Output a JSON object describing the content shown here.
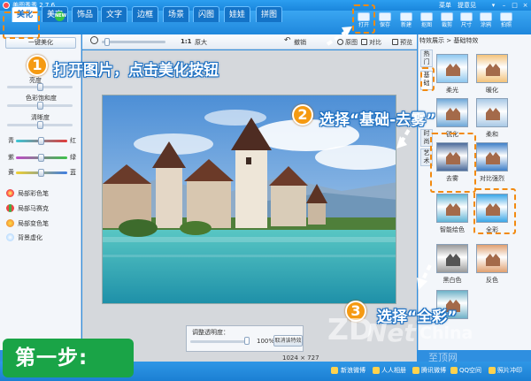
{
  "app": {
    "title": "美图秀秀 2.7.6"
  },
  "system_menu": {
    "menu": "菜单",
    "feedback": "提意见"
  },
  "tabs": [
    {
      "label": "美化"
    },
    {
      "label": "美容"
    },
    {
      "label": "饰品"
    },
    {
      "label": "文字"
    },
    {
      "label": "边框"
    },
    {
      "label": "场景"
    },
    {
      "label": "闪图"
    },
    {
      "label": "娃娃"
    },
    {
      "label": "拼图"
    }
  ],
  "new_badge": "NEW",
  "toolbar": [
    {
      "label": "打开",
      "icon": "folder-open-icon"
    },
    {
      "label": "保存",
      "icon": "save-icon"
    },
    {
      "label": "新建",
      "icon": "new-icon"
    },
    {
      "label": "抠图",
      "icon": "cutout-icon"
    },
    {
      "label": "裁剪",
      "icon": "crop-icon"
    },
    {
      "label": "尺寸",
      "icon": "resize-icon"
    },
    {
      "label": "涂鸦",
      "icon": "brush-icon"
    },
    {
      "label": "拍照",
      "icon": "camera-icon"
    }
  ],
  "left_panel": {
    "one_click": "一键美化",
    "sliders": [
      {
        "label": "亮度",
        "value": 0.5
      },
      {
        "label": "色彩饱和度",
        "value": 0.5
      },
      {
        "label": "清晰度",
        "value": 0.5
      }
    ],
    "color_sliders": [
      {
        "left": "青",
        "right": "红",
        "value": 0.5
      },
      {
        "left": "紫",
        "right": "绿",
        "value": 0.5
      },
      {
        "left": "黄",
        "right": "蓝",
        "value": 0.5
      }
    ],
    "tools": [
      {
        "label": "局部彩色笔"
      },
      {
        "label": "局部马赛克"
      },
      {
        "label": "局部变色笔"
      },
      {
        "label": "背景虚化"
      }
    ]
  },
  "center_toolbar": {
    "ratio": "1:1",
    "original": "原大",
    "undo": "撤销",
    "show_original": "原图",
    "compare": "对比",
    "preview": "预览"
  },
  "transparency": {
    "title": "调整透明度：",
    "value": "100%",
    "cancel": "取消该特效"
  },
  "image_size": {
    "width": "1024",
    "sep": "×",
    "height": "727"
  },
  "right_panel": {
    "breadcrumb": "特效展示 > 基础特效",
    "side_tabs": [
      "热门",
      "基础",
      "时尚",
      "艺术"
    ],
    "effects": [
      {
        "label": "柔光"
      },
      {
        "label": "暖化"
      },
      {
        "label": "锐化"
      },
      {
        "label": "柔和"
      },
      {
        "label": "去雾"
      },
      {
        "label": "对比强烈"
      },
      {
        "label": "智能绘色"
      },
      {
        "label": "全彩"
      },
      {
        "label": "黑白色"
      },
      {
        "label": "反色"
      },
      {
        "label": ""
      }
    ]
  },
  "statusbar": [
    "新浪微博",
    "人人相册",
    "腾讯微博",
    "QQ空间",
    "照片冲印"
  ],
  "annotations": {
    "step1_num": "1",
    "step1_text": "打开图片，点击美化按钮",
    "step2_num": "2",
    "step2_text": "选择“基础-去雾”",
    "step3_num": "3",
    "step3_text": "选择“全彩”",
    "step_badge": "第一步:"
  },
  "watermark": {
    "zd": "ZD",
    "net": "Net",
    "china": "China",
    "cn": "至顶网"
  }
}
